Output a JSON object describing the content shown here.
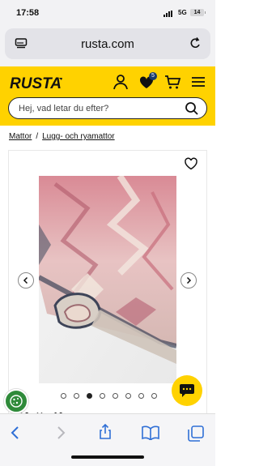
{
  "status": {
    "time": "17:58",
    "network": "5G",
    "battery": "14"
  },
  "browser": {
    "url": "rusta.com"
  },
  "header": {
    "logo": "RUSTA",
    "wishlist_count": "5"
  },
  "search": {
    "placeholder": "Hej, vad letar du efter?"
  },
  "breadcrumb": {
    "items": [
      "Mattor",
      "Lugg- och ryamattor"
    ],
    "separator": "/"
  },
  "product": {
    "title_peek": "Matta Kaya",
    "gallery_dots": 8,
    "active_dot": 2
  },
  "colors": {
    "brand_yellow": "#ffd200",
    "cookie_green": "#2f8a3a"
  },
  "icons": [
    "tabs-icon",
    "reload-icon",
    "account-icon",
    "heart-icon",
    "cart-icon",
    "menu-icon",
    "search-icon",
    "wishlist-heart-icon",
    "chevron-left-icon",
    "chevron-right-icon",
    "chat-icon",
    "cookie-icon",
    "back-icon",
    "forward-icon",
    "share-icon",
    "bookmarks-icon",
    "tabs-overview-icon"
  ]
}
